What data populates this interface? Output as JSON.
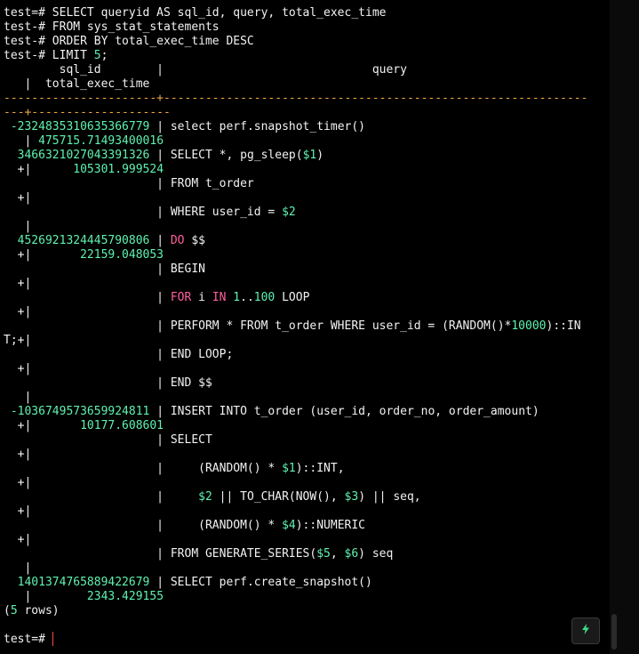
{
  "terminal": {
    "lines": [
      [
        {
          "t": "test=# SELECT queryid AS sql_id, query, total_exec_time",
          "c": "w"
        }
      ],
      [
        {
          "t": "test-# FROM sys_stat_statements",
          "c": "w"
        }
      ],
      [
        {
          "t": "test-# ORDER BY total_exec_time DESC",
          "c": "w"
        }
      ],
      [
        {
          "t": "test-# LIMIT ",
          "c": "w"
        },
        {
          "t": "5",
          "c": "g"
        },
        {
          "t": ";",
          "c": "w"
        }
      ],
      [
        {
          "t": "        sql_id        |                              query",
          "c": "w"
        }
      ],
      [
        {
          "t": "   |  total_exec_time",
          "c": "w"
        }
      ],
      [
        {
          "t": "----------------------+-------------------------------------------------------------",
          "c": "o"
        }
      ],
      [
        {
          "t": "---+--------------------",
          "c": "o"
        }
      ],
      [
        {
          "t": " -2324835310635366779",
          "c": "g"
        },
        {
          "t": " | select perf.snapshot_timer()",
          "c": "w"
        }
      ],
      [
        {
          "t": "   | ",
          "c": "w"
        },
        {
          "t": "475715.71493400016",
          "c": "g"
        }
      ],
      [
        {
          "t": "  3466321027043391326",
          "c": "g"
        },
        {
          "t": " | SELECT *, pg_sleep(",
          "c": "w"
        },
        {
          "t": "$1",
          "c": "g"
        },
        {
          "t": ")",
          "c": "w"
        }
      ],
      [
        {
          "t": "  +|      ",
          "c": "w"
        },
        {
          "t": "105301.999524",
          "c": "g"
        }
      ],
      [
        {
          "t": "                      | FROM t_order",
          "c": "w"
        }
      ],
      [
        {
          "t": "  +|",
          "c": "w"
        }
      ],
      [
        {
          "t": "                      | WHERE user_id = ",
          "c": "w"
        },
        {
          "t": "$2",
          "c": "g"
        }
      ],
      [
        {
          "t": "   |",
          "c": "w"
        }
      ],
      [
        {
          "t": "  4526921324445790806",
          "c": "g"
        },
        {
          "t": " | ",
          "c": "w"
        },
        {
          "t": "DO",
          "c": "p"
        },
        {
          "t": " $$",
          "c": "w"
        }
      ],
      [
        {
          "t": "  +|       ",
          "c": "w"
        },
        {
          "t": "22159.048053",
          "c": "g"
        }
      ],
      [
        {
          "t": "                      | BEGIN",
          "c": "w"
        }
      ],
      [
        {
          "t": "  +|",
          "c": "w"
        }
      ],
      [
        {
          "t": "                      | ",
          "c": "w"
        },
        {
          "t": "FOR",
          "c": "p"
        },
        {
          "t": " i ",
          "c": "w"
        },
        {
          "t": "IN",
          "c": "p"
        },
        {
          "t": " ",
          "c": "w"
        },
        {
          "t": "1",
          "c": "g"
        },
        {
          "t": "..",
          "c": "w"
        },
        {
          "t": "100",
          "c": "g"
        },
        {
          "t": " LOOP",
          "c": "w"
        }
      ],
      [
        {
          "t": "  +|",
          "c": "w"
        }
      ],
      [
        {
          "t": "                      | PERFORM * FROM t_order WHERE user_id = (RANDOM()*",
          "c": "w"
        },
        {
          "t": "10000",
          "c": "g"
        },
        {
          "t": ")::IN",
          "c": "w"
        }
      ],
      [
        {
          "t": "T;+|",
          "c": "w"
        }
      ],
      [
        {
          "t": "                      | END LOOP;",
          "c": "w"
        }
      ],
      [
        {
          "t": "  +|",
          "c": "w"
        }
      ],
      [
        {
          "t": "                      | END $$",
          "c": "w"
        }
      ],
      [
        {
          "t": "   |",
          "c": "w"
        }
      ],
      [
        {
          "t": " -1036749573659924811",
          "c": "g"
        },
        {
          "t": " | INSERT INTO t_order (user_id, order_no, order_amount)",
          "c": "w"
        }
      ],
      [
        {
          "t": "  +|       ",
          "c": "w"
        },
        {
          "t": "10177.608601",
          "c": "g"
        }
      ],
      [
        {
          "t": "                      | SELECT",
          "c": "w"
        }
      ],
      [
        {
          "t": "  +|",
          "c": "w"
        }
      ],
      [
        {
          "t": "                      |     (RANDOM() * ",
          "c": "w"
        },
        {
          "t": "$1",
          "c": "g"
        },
        {
          "t": ")::INT,",
          "c": "w"
        }
      ],
      [
        {
          "t": "  +|",
          "c": "w"
        }
      ],
      [
        {
          "t": "                      |     ",
          "c": "w"
        },
        {
          "t": "$2",
          "c": "g"
        },
        {
          "t": " || TO_CHAR(NOW(), ",
          "c": "w"
        },
        {
          "t": "$3",
          "c": "g"
        },
        {
          "t": ") || seq,",
          "c": "w"
        }
      ],
      [
        {
          "t": "  +|",
          "c": "w"
        }
      ],
      [
        {
          "t": "                      |     (RANDOM() * ",
          "c": "w"
        },
        {
          "t": "$4",
          "c": "g"
        },
        {
          "t": ")::NUMERIC",
          "c": "w"
        }
      ],
      [
        {
          "t": "  +|",
          "c": "w"
        }
      ],
      [
        {
          "t": "                      | FROM GENERATE_SERIES(",
          "c": "w"
        },
        {
          "t": "$5",
          "c": "g"
        },
        {
          "t": ", ",
          "c": "w"
        },
        {
          "t": "$6",
          "c": "g"
        },
        {
          "t": ") seq",
          "c": "w"
        }
      ],
      [
        {
          "t": "   |",
          "c": "w"
        }
      ],
      [
        {
          "t": "  1401374765889422679",
          "c": "g"
        },
        {
          "t": " | SELECT perf.create_snapshot()",
          "c": "w"
        }
      ],
      [
        {
          "t": "   |        ",
          "c": "w"
        },
        {
          "t": "2343.429155",
          "c": "g"
        }
      ],
      [
        {
          "t": "(",
          "c": "w"
        },
        {
          "t": "5",
          "c": "g"
        },
        {
          "t": " rows)",
          "c": "w"
        }
      ],
      [
        {
          "t": "",
          "c": "w"
        }
      ],
      [
        {
          "t": "test=# ",
          "c": "w"
        }
      ]
    ]
  },
  "ui": {
    "tool_button_icon": "lightning-icon",
    "accent_green": "#5ff2b0",
    "accent_pink": "#ff5f9e",
    "accent_orange": "#f0a640"
  }
}
